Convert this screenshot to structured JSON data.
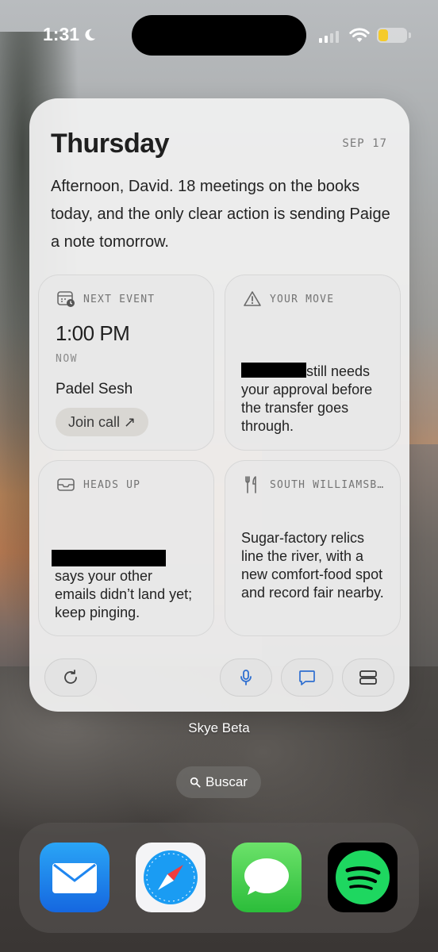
{
  "status_bar": {
    "time": "1:31",
    "battery_level": 0.35,
    "colors": {
      "battery": "#f5cb2a"
    }
  },
  "widget": {
    "day": "Thursday",
    "date": "SEP 17",
    "summary": "Afternoon, David. 18 meetings on the books today, and the only clear action is sending Paige a note tomorrow.",
    "next_event": {
      "label": "NEXT EVENT",
      "time": "1:00 PM",
      "status": "NOW",
      "name": "Padel Sesh",
      "join_label": "Join call ↗"
    },
    "your_move": {
      "label": "YOUR MOVE",
      "text_after_redaction": "still needs",
      "text": "your approval before the transfer goes through."
    },
    "heads_up": {
      "label": "HEADS UP",
      "text": "says your other emails didn’t land yet; keep pinging."
    },
    "local": {
      "label": "SOUTH WILLIAMSB…",
      "text": "Sugar-factory relics line the river, with a new comfort-food spot and record fair nearby."
    },
    "buttons": [
      "refresh-icon",
      "microphone-icon",
      "chat-icon",
      "layout-icon"
    ]
  },
  "widget_caption": "Skye Beta",
  "search": {
    "label": "Buscar"
  },
  "dock": {
    "apps": [
      "mail-icon",
      "safari-icon",
      "messages-icon",
      "spotify-icon"
    ],
    "colors": {
      "mail": "#1f86f0",
      "messages": "#3ccb45",
      "spotify": "#1ed760"
    }
  }
}
